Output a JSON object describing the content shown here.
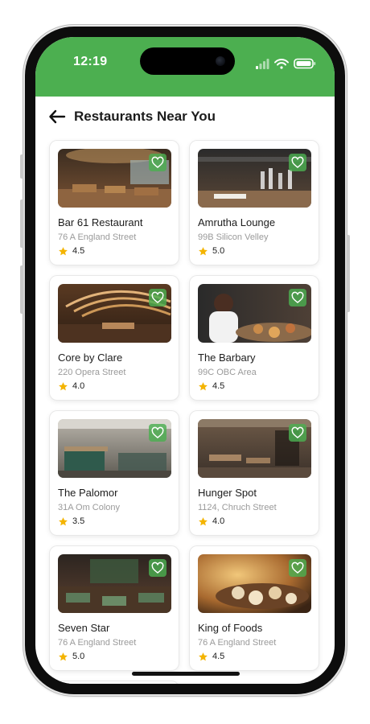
{
  "status_bar": {
    "time": "12:19",
    "background": "#4caf50"
  },
  "header": {
    "title": "Restaurants Near You",
    "back_icon": "arrow-left-icon"
  },
  "accent": "#4caf50",
  "star_color": "#f4b400",
  "restaurants": [
    {
      "name": "Bar 61 Restaurant",
      "address": "76 A England Street",
      "rating": "4.5",
      "favorite_icon": "heart-outline-icon"
    },
    {
      "name": "Amrutha Lounge",
      "address": "99B Silicon Velley",
      "rating": "5.0",
      "favorite_icon": "heart-outline-icon"
    },
    {
      "name": "Core by Clare",
      "address": "220 Opera Street",
      "rating": "4.0",
      "favorite_icon": "heart-outline-icon"
    },
    {
      "name": "The Barbary",
      "address": "99C OBC Area",
      "rating": "4.5",
      "favorite_icon": "heart-outline-icon"
    },
    {
      "name": "The Palomor",
      "address": "31A Om Colony",
      "rating": "3.5",
      "favorite_icon": "heart-outline-icon"
    },
    {
      "name": "Hunger Spot",
      "address": "1124, Chruch Street",
      "rating": "4.0",
      "favorite_icon": "heart-outline-icon"
    },
    {
      "name": "Seven Star",
      "address": "76 A England Street",
      "rating": "5.0",
      "favorite_icon": "heart-outline-icon"
    },
    {
      "name": "King of Foods",
      "address": "76 A England Street",
      "rating": "4.5",
      "favorite_icon": "heart-outline-icon"
    }
  ]
}
